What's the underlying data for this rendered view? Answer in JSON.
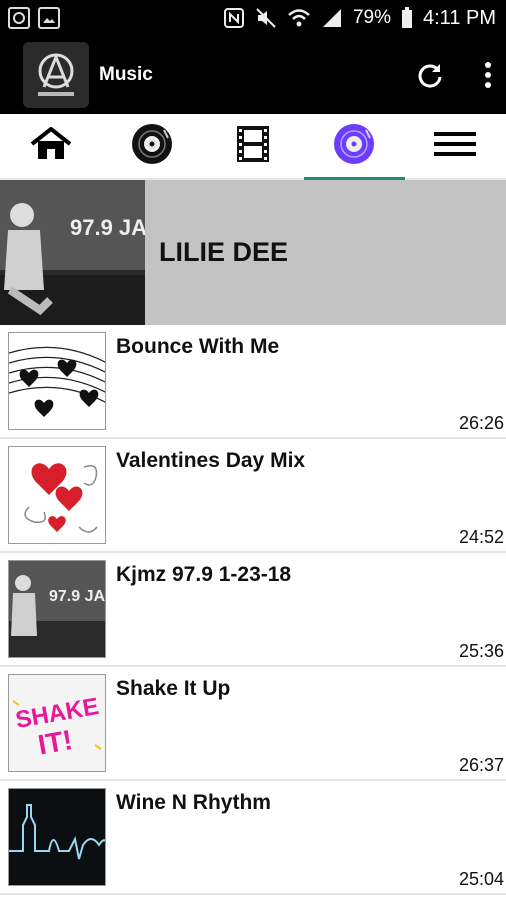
{
  "status": {
    "battery": "79%",
    "time": "4:11 PM"
  },
  "appbar": {
    "title": "Music"
  },
  "artist": {
    "name": "LILIE DEE"
  },
  "tracks": [
    {
      "title": "Bounce With Me",
      "duration": "26:26"
    },
    {
      "title": "Valentines Day Mix",
      "duration": "24:52"
    },
    {
      "title": "Kjmz 97.9 1-23-18",
      "duration": "25:36"
    },
    {
      "title": "Shake It Up",
      "duration": "26:37"
    },
    {
      "title": "Wine N Rhythm",
      "duration": "25:04"
    }
  ],
  "colors": {
    "accent": "#1f8a83",
    "active_tab_icon": "#6c3cff",
    "header_bg": "#000000"
  },
  "icons": [
    "home-icon",
    "vinyl-icon",
    "film-icon",
    "vinyl-active-icon",
    "menu-icon",
    "refresh-icon",
    "more-vert-icon"
  ]
}
